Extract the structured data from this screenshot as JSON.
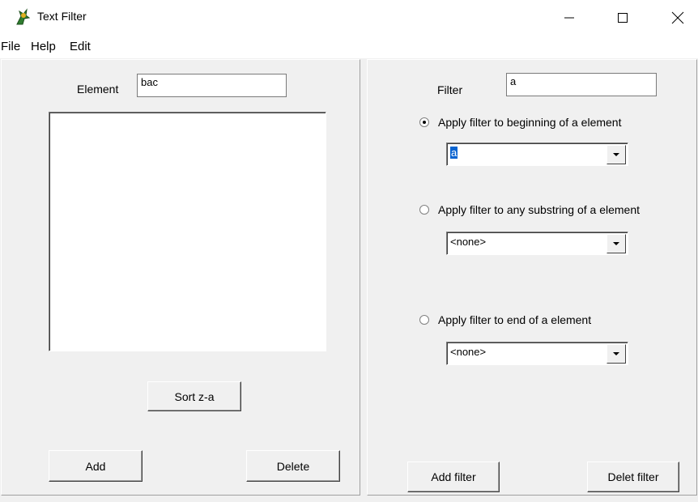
{
  "window": {
    "title": "Text Filter"
  },
  "menu": [
    "File",
    "Help",
    "Edit"
  ],
  "left": {
    "element_label": "Element",
    "element_value": "bac",
    "sort_button": "Sort z-a",
    "add_button": "Add",
    "delete_button": "Delete"
  },
  "right": {
    "filter_label": "Filter",
    "filter_value": "a",
    "options": [
      {
        "label": "Apply filter to beginning of a element",
        "selected": true,
        "combo_value": "a"
      },
      {
        "label": "Apply filter to any substring of a element",
        "selected": false,
        "combo_value": "<none>"
      },
      {
        "label": "Apply filter to end of a element",
        "selected": false,
        "combo_value": "<none>"
      }
    ],
    "add_filter_button": "Add filter",
    "delete_filter_button": "Delet filter"
  }
}
